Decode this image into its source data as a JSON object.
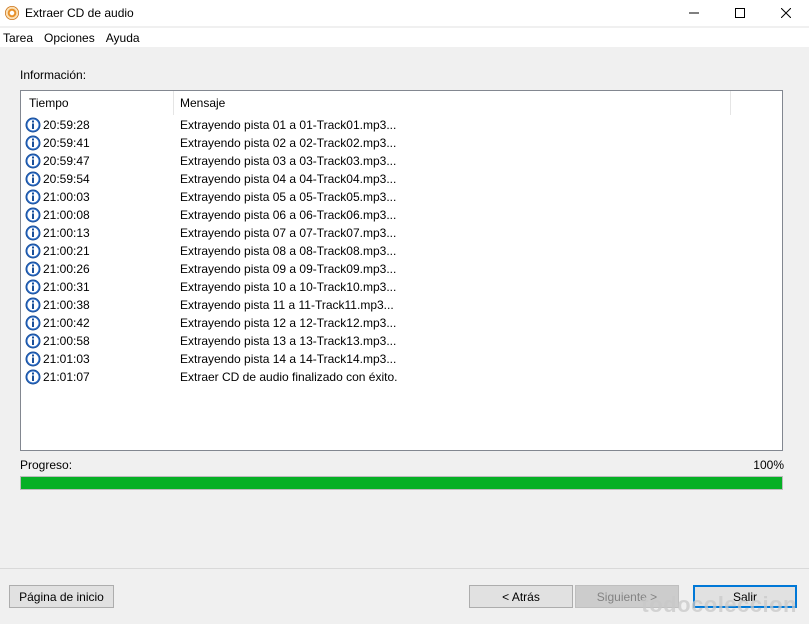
{
  "window": {
    "title": "Extraer CD de audio",
    "icon": "cd-audio-icon",
    "controls": [
      "minimize-icon",
      "maximize-icon",
      "close-icon"
    ]
  },
  "menu": {
    "items": [
      {
        "label": "Tarea"
      },
      {
        "label": "Opciones"
      },
      {
        "label": "Ayuda"
      }
    ]
  },
  "info": {
    "label": "Información:",
    "columns": [
      "Tiempo",
      "Mensaje"
    ],
    "rows": [
      {
        "time": "20:59:28",
        "message": "Extrayendo pista 01 a 01-Track01.mp3..."
      },
      {
        "time": "20:59:41",
        "message": "Extrayendo pista 02 a 02-Track02.mp3..."
      },
      {
        "time": "20:59:47",
        "message": "Extrayendo pista 03 a 03-Track03.mp3..."
      },
      {
        "time": "20:59:54",
        "message": "Extrayendo pista 04 a 04-Track04.mp3..."
      },
      {
        "time": "21:00:03",
        "message": "Extrayendo pista 05 a 05-Track05.mp3..."
      },
      {
        "time": "21:00:08",
        "message": "Extrayendo pista 06 a 06-Track06.mp3..."
      },
      {
        "time": "21:00:13",
        "message": "Extrayendo pista 07 a 07-Track07.mp3..."
      },
      {
        "time": "21:00:21",
        "message": "Extrayendo pista 08 a 08-Track08.mp3..."
      },
      {
        "time": "21:00:26",
        "message": "Extrayendo pista 09 a 09-Track09.mp3..."
      },
      {
        "time": "21:00:31",
        "message": "Extrayendo pista 10 a 10-Track10.mp3..."
      },
      {
        "time": "21:00:38",
        "message": "Extrayendo pista 11 a 11-Track11.mp3..."
      },
      {
        "time": "21:00:42",
        "message": "Extrayendo pista 12 a 12-Track12.mp3..."
      },
      {
        "time": "21:00:58",
        "message": "Extrayendo pista 13 a 13-Track13.mp3..."
      },
      {
        "time": "21:01:03",
        "message": "Extrayendo pista 14 a 14-Track14.mp3..."
      },
      {
        "time": "21:01:07",
        "message": "Extraer CD de audio finalizado con éxito."
      }
    ],
    "row_icon": "info-icon"
  },
  "progress": {
    "label": "Progreso:",
    "percent_text": "100%",
    "value": 1.0,
    "color": "#06b025"
  },
  "buttons": {
    "home": "Página de inicio",
    "back": "< Atrás",
    "next": "Siguiente >",
    "exit": "Salir"
  },
  "watermark": "todocoleccion"
}
